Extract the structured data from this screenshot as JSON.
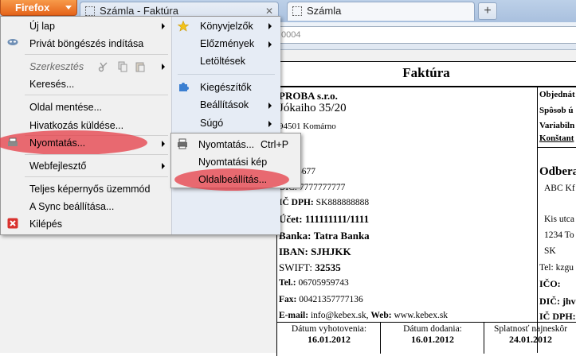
{
  "browser": {
    "app_button": "Firefox",
    "tabs": [
      {
        "label": "Számla - Faktúra"
      },
      {
        "label": "Számla"
      }
    ],
    "new_tab": "+",
    "url_fragment": "0004"
  },
  "menu": {
    "left": [
      {
        "label": "Új lap"
      },
      {
        "label": "Privát böngészés indítása"
      },
      {
        "label": "Szerkesztés"
      },
      {
        "label": "Keresés..."
      },
      {
        "label": "Oldal mentése..."
      },
      {
        "label": "Hivatkozás küldése..."
      },
      {
        "label": "Nyomtatás..."
      },
      {
        "label": "Webfejlesztő"
      },
      {
        "label": "Teljes képernyős üzemmód"
      },
      {
        "label": "A Sync beállítása..."
      },
      {
        "label": "Kilépés"
      }
    ],
    "right": [
      {
        "label": "Könyvjelzők"
      },
      {
        "label": "Előzmények"
      },
      {
        "label": "Letöltések"
      },
      {
        "label": "Kiegészítők"
      },
      {
        "label": "Beállítások"
      },
      {
        "label": "Súgó"
      }
    ],
    "print_submenu": [
      {
        "label": "Nyomtatás...",
        "shortcut": "Ctrl+P"
      },
      {
        "label": "Nyomtatási kép"
      },
      {
        "label": "Oldalbeállítás..."
      }
    ]
  },
  "invoice": {
    "title": "Faktúra",
    "company": "PROBA s.r.o.",
    "street": "Jókaiho 35/20",
    "city": "94501 Komárno",
    "ico_val": "44556677",
    "dic_val": "DIČ: 7777777777",
    "icdph_label": "IČ DPH:",
    "icdph_val": "SK888888888",
    "ucet_label": "Účet:",
    "ucet_val": "111111111/1111",
    "banka_label": "Banka:",
    "banka_val": "Tatra Banka",
    "iban": "IBAN: SJHJKK",
    "swift_label": "SWIFT:",
    "swift_val": "32535",
    "tel_label": "Tel.:",
    "tel_val": "06705959743",
    "fax_label": "Fax:",
    "fax_val": "00421357777136",
    "email_label": "E-mail:",
    "email_val": "info@kebex.sk",
    "web_label": "Web:",
    "web_val": "www.kebex.sk",
    "right_col": {
      "objednat": "Objednát",
      "sposob": "Spôsob ú",
      "variabil": "Variabiln",
      "konstant": "Konštant",
      "odbera": "Odbera",
      "abc": "ABC Kf",
      "kis": "Kis utca",
      "zip": "1234 To",
      "sk": "SK",
      "tel": "Tel: kzgu",
      "ico": "IČO:",
      "dic": "DIČ: jhv",
      "icdph": "IČ DPH:"
    },
    "dates": [
      {
        "label": "Dátum vyhotovenia:",
        "value": "16.01.2012"
      },
      {
        "label": "Dátum dodania:",
        "value": "16.01.2012"
      },
      {
        "label": "Splatnosť najneskôr",
        "value": "24.01.2012"
      }
    ]
  },
  "colors": {
    "firefox_orange": "#e5641a",
    "highlight": "#e63c46",
    "menu_bg": "#f0f0f0"
  }
}
